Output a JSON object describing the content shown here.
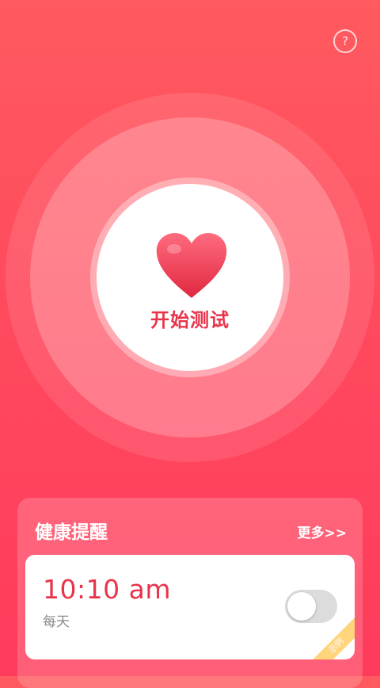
{
  "header": {
    "help_icon_glyph": "?"
  },
  "main": {
    "start_label": "开始测试"
  },
  "reminders": {
    "title": "健康提醒",
    "more_label": "更多>>",
    "items": [
      {
        "time": "10:10 am",
        "repeat": "每天",
        "enabled": false,
        "badge": "示例"
      }
    ]
  },
  "colors": {
    "accent": "#e8344b",
    "background_top": "#ff5a5f",
    "background_bottom": "#ff3b5c",
    "badge": "#ffd47a"
  }
}
